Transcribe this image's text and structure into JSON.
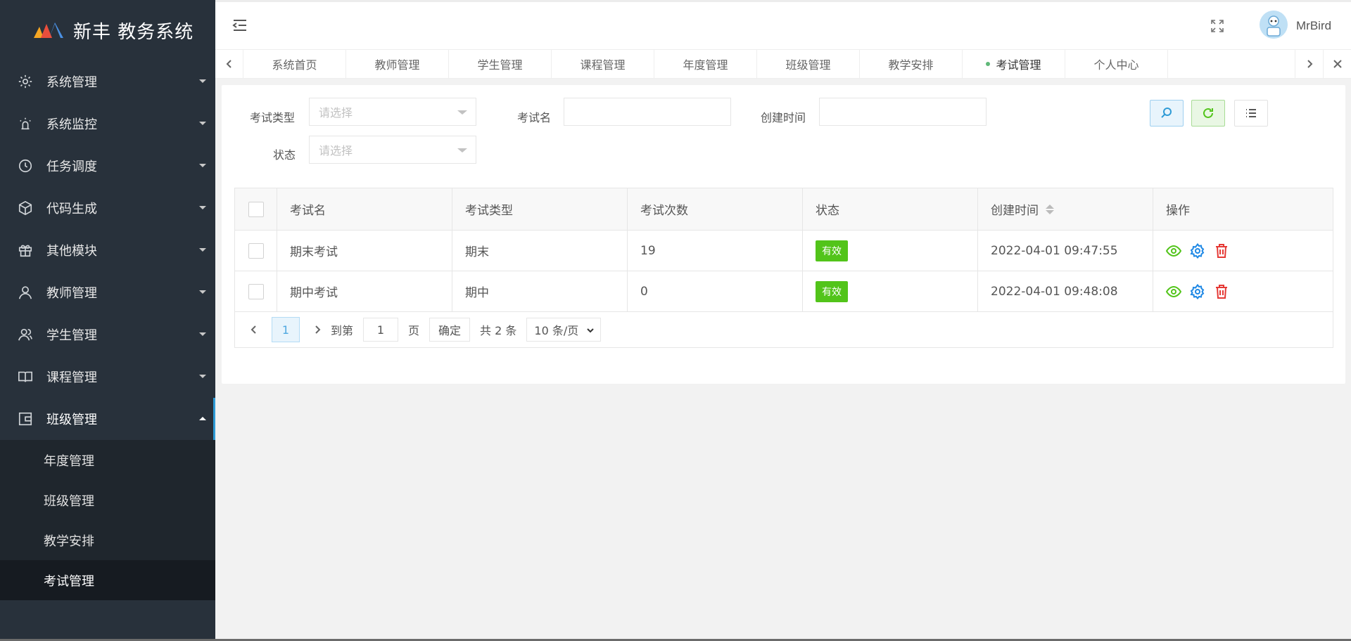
{
  "app": {
    "title": "新丰 教务系统"
  },
  "sidebar": {
    "items": [
      {
        "label": "系统管理",
        "icon": "gear-icon"
      },
      {
        "label": "系统监控",
        "icon": "alarm-icon"
      },
      {
        "label": "任务调度",
        "icon": "clock-icon"
      },
      {
        "label": "代码生成",
        "icon": "cube-icon"
      },
      {
        "label": "其他模块",
        "icon": "gift-icon"
      },
      {
        "label": "教师管理",
        "icon": "user-icon"
      },
      {
        "label": "学生管理",
        "icon": "users-icon"
      },
      {
        "label": "课程管理",
        "icon": "book-icon"
      },
      {
        "label": "班级管理",
        "icon": "wallet-icon"
      }
    ],
    "submenu": [
      "年度管理",
      "班级管理",
      "教学安排",
      "考试管理"
    ]
  },
  "header": {
    "username": "MrBird"
  },
  "tabs": [
    "系统首页",
    "教师管理",
    "学生管理",
    "课程管理",
    "年度管理",
    "班级管理",
    "教学安排",
    "考试管理",
    "个人中心"
  ],
  "filters": {
    "exam_type_label": "考试类型",
    "exam_type_placeholder": "请选择",
    "exam_name_label": "考试名",
    "created_label": "创建时间",
    "status_label": "状态",
    "status_placeholder": "请选择"
  },
  "table": {
    "headers": [
      "考试名",
      "考试类型",
      "考试次数",
      "状态",
      "创建时间",
      "操作"
    ],
    "rows": [
      {
        "name": "期末考试",
        "type": "期末",
        "count": "19",
        "status": "有效",
        "created": "2022-04-01 09:47:55"
      },
      {
        "name": "期中考试",
        "type": "期中",
        "count": "0",
        "status": "有效",
        "created": "2022-04-01 09:48:08"
      }
    ]
  },
  "pager": {
    "current": "1",
    "goto": "到第",
    "page_input": "1",
    "page_unit": "页",
    "confirm": "确定",
    "total": "共 2 条",
    "limit": "10 条/页"
  },
  "colors": {
    "sidebar_bg": "#28313b",
    "accent": "#2f9bd6",
    "valid_badge": "#52c41a"
  }
}
